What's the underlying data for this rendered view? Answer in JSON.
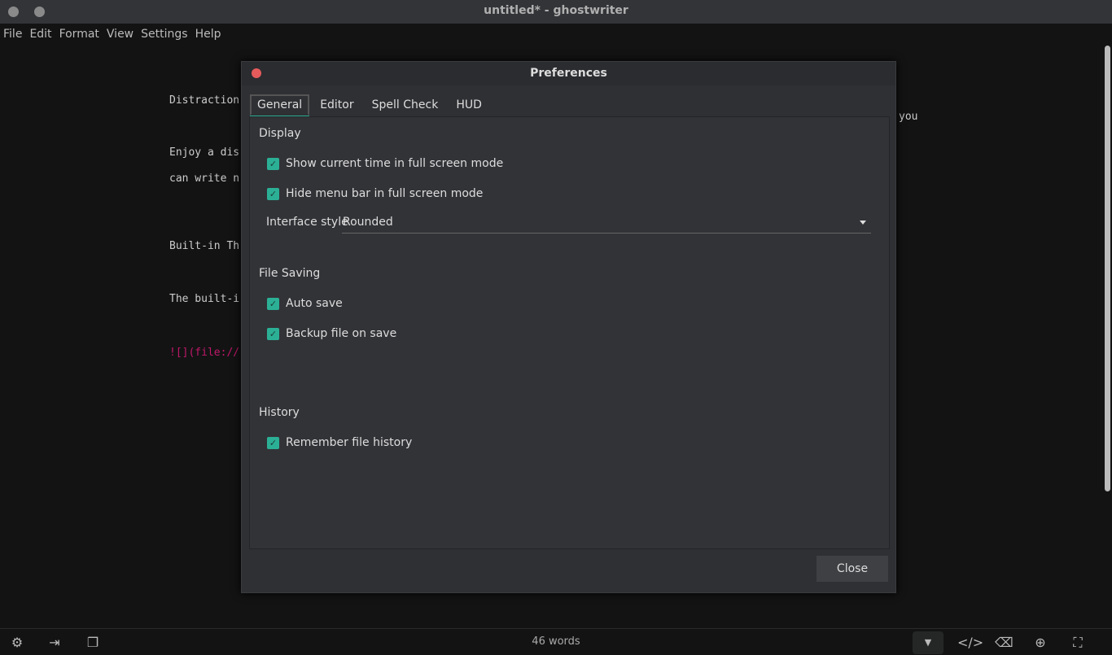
{
  "window": {
    "title": "untitled* - ghostwriter"
  },
  "menu": [
    "File",
    "Edit",
    "Format",
    "View",
    "Settings",
    "Help"
  ],
  "editor": {
    "lines": [
      "Distraction",
      "",
      "Enjoy a dis",
      "can write n",
      "",
      "",
      "Built-in Th",
      "",
      "The built-i",
      "",
      "![](file://"
    ],
    "line2_tail": "you",
    "link_color": "#c0186a"
  },
  "status": {
    "word_count": "46 words",
    "icons": [
      "gear-icon",
      "export-icon",
      "copy-icon",
      "chevron-down-icon",
      "code-icon",
      "backspace-icon",
      "crosshair-icon",
      "fullscreen-icon"
    ]
  },
  "dialog": {
    "title": "Preferences",
    "tabs": [
      "General",
      "Editor",
      "Spell Check",
      "HUD"
    ],
    "active_tab": "General",
    "sections": {
      "display": {
        "title": "Display",
        "show_time": "Show current time in full screen mode",
        "hide_menu": "Hide menu bar in full screen mode",
        "interface_label": "Interface style",
        "interface_value": "Rounded"
      },
      "saving": {
        "title": "File Saving",
        "auto_save": "Auto save",
        "backup": "Backup file on save"
      },
      "history": {
        "title": "History",
        "remember": "Remember file history"
      }
    },
    "checked": {
      "show_time": true,
      "hide_menu": true,
      "auto_save": true,
      "backup": true,
      "remember": true
    },
    "close_label": "Close",
    "accent": "#2bb096"
  }
}
